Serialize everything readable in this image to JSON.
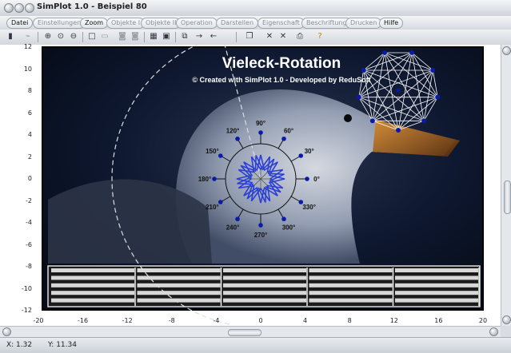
{
  "window": {
    "title": "SimPlot 1.0 - Beispiel 80"
  },
  "menu": [
    {
      "label": "Datei",
      "active": true
    },
    {
      "label": "Einstellungen",
      "active": false
    },
    {
      "label": "Zoom",
      "active": true
    },
    {
      "label": "Objekte I",
      "active": false
    },
    {
      "label": "Objekte II",
      "active": false
    },
    {
      "label": "Operation",
      "active": false
    },
    {
      "label": "Darstellen",
      "active": false
    },
    {
      "label": "Eigenschaft",
      "active": false
    },
    {
      "label": "Beschriftung",
      "active": false
    },
    {
      "label": "Drucken",
      "active": false
    },
    {
      "label": "Hilfe",
      "active": true
    }
  ],
  "toolbar_icons": [
    "calculator-icon",
    "ruler-icon",
    "zoom-in-icon",
    "zoom-fit-icon",
    "zoom-out-icon",
    "square-icon",
    "text-box-icon",
    "record-icon",
    "record2-icon",
    "table-icon",
    "image-select-icon",
    "copy-icon",
    "right-arrow-icon",
    "left-arrow-icon",
    "pages-icon",
    "cross-icon",
    "cross2-icon",
    "printer-icon",
    "help-icon"
  ],
  "plot": {
    "title": "Vieleck-Rotation",
    "subtitle": "© Created with SimPlot 1.0 - Developed by ReduSoft",
    "angle_labels": [
      "0°",
      "30°",
      "60°",
      "90°",
      "120°",
      "150°",
      "180°",
      "210°",
      "240°",
      "270°",
      "300°",
      "330°"
    ],
    "x_ticks": [
      "-20",
      "-16",
      "-12",
      "-8",
      "-4",
      "0",
      "4",
      "8",
      "12",
      "16",
      "20"
    ],
    "y_ticks": [
      "12",
      "10",
      "8",
      "6",
      "4",
      "2",
      "0",
      "-2",
      "-4",
      "-6",
      "-8",
      "-10",
      "-12"
    ],
    "x_range": [
      -20,
      20
    ],
    "y_range": [
      -12,
      12
    ],
    "colors": {
      "background": "#0c1428",
      "star": "#2a3fd6",
      "point": "#0a1aa8",
      "arc": "#dddddd",
      "title": "#ffffff"
    }
  },
  "status": {
    "x": "X: 1.32",
    "y": "Y: 11.34"
  }
}
